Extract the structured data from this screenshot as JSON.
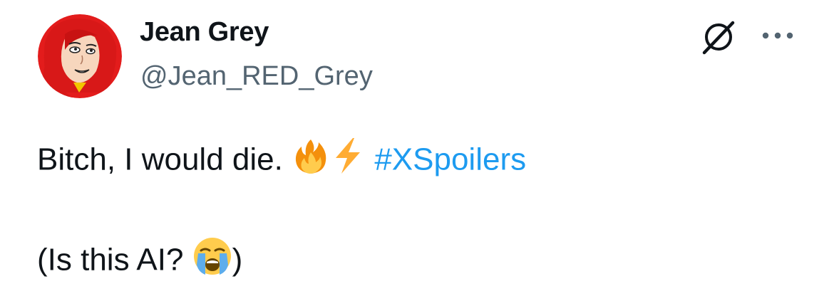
{
  "author": {
    "display_name": "Jean Grey",
    "handle": "@Jean_RED_Grey",
    "avatar_icon": "comic-avatar"
  },
  "header_actions": {
    "grok_icon": "grok-icon",
    "more_icon": "more-horizontal-icon"
  },
  "post": {
    "line1_text": "Bitch, I would die.",
    "line1_emojis": [
      "fire-emoji",
      "lightning-emoji"
    ],
    "hashtag": "#XSpoilers",
    "line2_prefix": "(Is this AI?",
    "line2_emoji": "loudly-crying-emoji",
    "line2_suffix": ")"
  },
  "colors": {
    "text": "#0f1419",
    "secondary": "#536471",
    "link": "#1d9bf0"
  }
}
